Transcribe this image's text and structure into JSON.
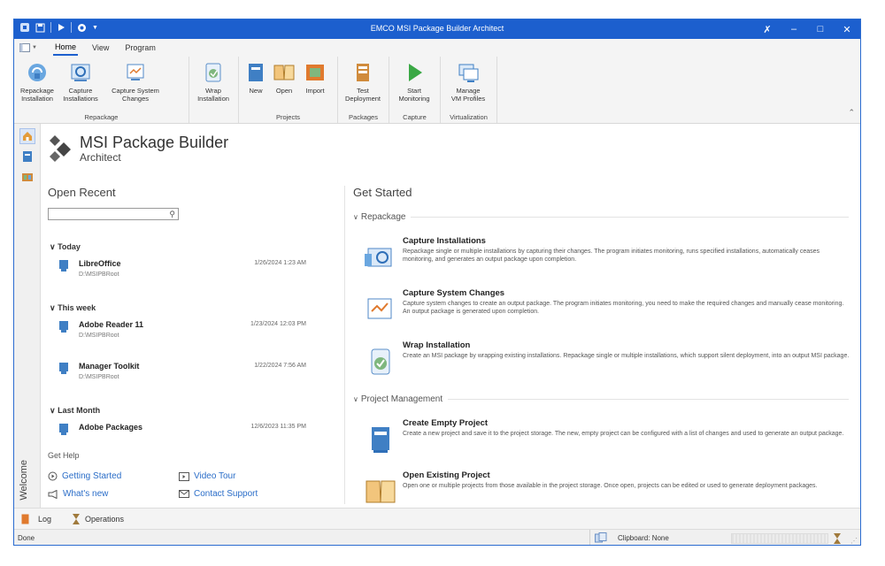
{
  "window": {
    "title": "EMCO MSI Package Builder Architect"
  },
  "menu": {
    "tabs": [
      "Home",
      "View",
      "Program"
    ],
    "active": "Home"
  },
  "ribbon": {
    "groups": [
      {
        "label": "Repackage",
        "buttons": [
          "Repackage\nInstallation",
          "Capture\nInstallations",
          "Capture System\nChanges"
        ]
      },
      {
        "label": "",
        "buttons": [
          "Wrap\nInstallation"
        ]
      },
      {
        "label": "Projects",
        "buttons": [
          "New",
          "Open",
          "Import"
        ]
      },
      {
        "label": "Packages",
        "buttons": [
          "Test\nDeployment"
        ]
      },
      {
        "label": "Capture",
        "buttons": [
          "Start\nMonitoring"
        ]
      },
      {
        "label": "Virtualization",
        "buttons": [
          "Manage\nVM Profiles"
        ]
      }
    ]
  },
  "brand": {
    "title": "MSI Package Builder",
    "subtitle": "Architect"
  },
  "sidebar": {
    "vertical_label": "Welcome"
  },
  "recent": {
    "heading": "Open Recent",
    "groups": [
      {
        "label": "Today",
        "items": [
          {
            "name": "LibreOffice",
            "path": "D:\\MSIPBRoot",
            "date": "1/26/2024 1:23 AM"
          }
        ]
      },
      {
        "label": "This week",
        "items": [
          {
            "name": "Adobe Reader 11",
            "path": "D:\\MSIPBRoot",
            "date": "1/23/2024 12:03 PM"
          },
          {
            "name": "Manager Toolkit",
            "path": "D:\\MSIPBRoot",
            "date": "1/22/2024 7:56 AM"
          }
        ]
      },
      {
        "label": "Last Month",
        "items": [
          {
            "name": "Adobe Packages",
            "path": "",
            "date": "12/6/2023 11:35 PM"
          }
        ]
      }
    ]
  },
  "help": {
    "heading": "Get Help",
    "links": [
      "Getting Started",
      "Video Tour",
      "What's new",
      "Contact Support"
    ]
  },
  "get_started": {
    "heading": "Get Started",
    "sections": [
      {
        "label": "Repackage",
        "items": [
          {
            "title": "Capture Installations",
            "desc": "Repackage single or multiple installations by capturing their changes. The program initiates monitoring, runs specified installations, automatically ceases monitoring, and generates an output package upon completion."
          },
          {
            "title": "Capture System Changes",
            "desc": "Capture system changes to create an output package. The program initiates monitoring, you need to make the required changes and manually cease monitoring. An output package is generated upon completion."
          },
          {
            "title": "Wrap Installation",
            "desc": "Create an MSI package by wrapping existing installations. Repackage single or multiple installations, which support silent deployment, into an output MSI package."
          }
        ]
      },
      {
        "label": "Project Management",
        "items": [
          {
            "title": "Create Empty Project",
            "desc": "Create a new project and save it to the project storage. The new, empty project can be configured with a list of changes and used to generate an output package."
          },
          {
            "title": "Open Existing Project",
            "desc": "Open one or multiple projects from those available in the project storage. Once open, projects can be edited or used to generate deployment packages."
          }
        ]
      }
    ]
  },
  "bottom_tabs": [
    "Log",
    "Operations"
  ],
  "status": {
    "left": "Done",
    "clipboard": "Clipboard: None"
  },
  "colors": {
    "accent": "#1c5fce",
    "link": "#2a6dc8"
  }
}
